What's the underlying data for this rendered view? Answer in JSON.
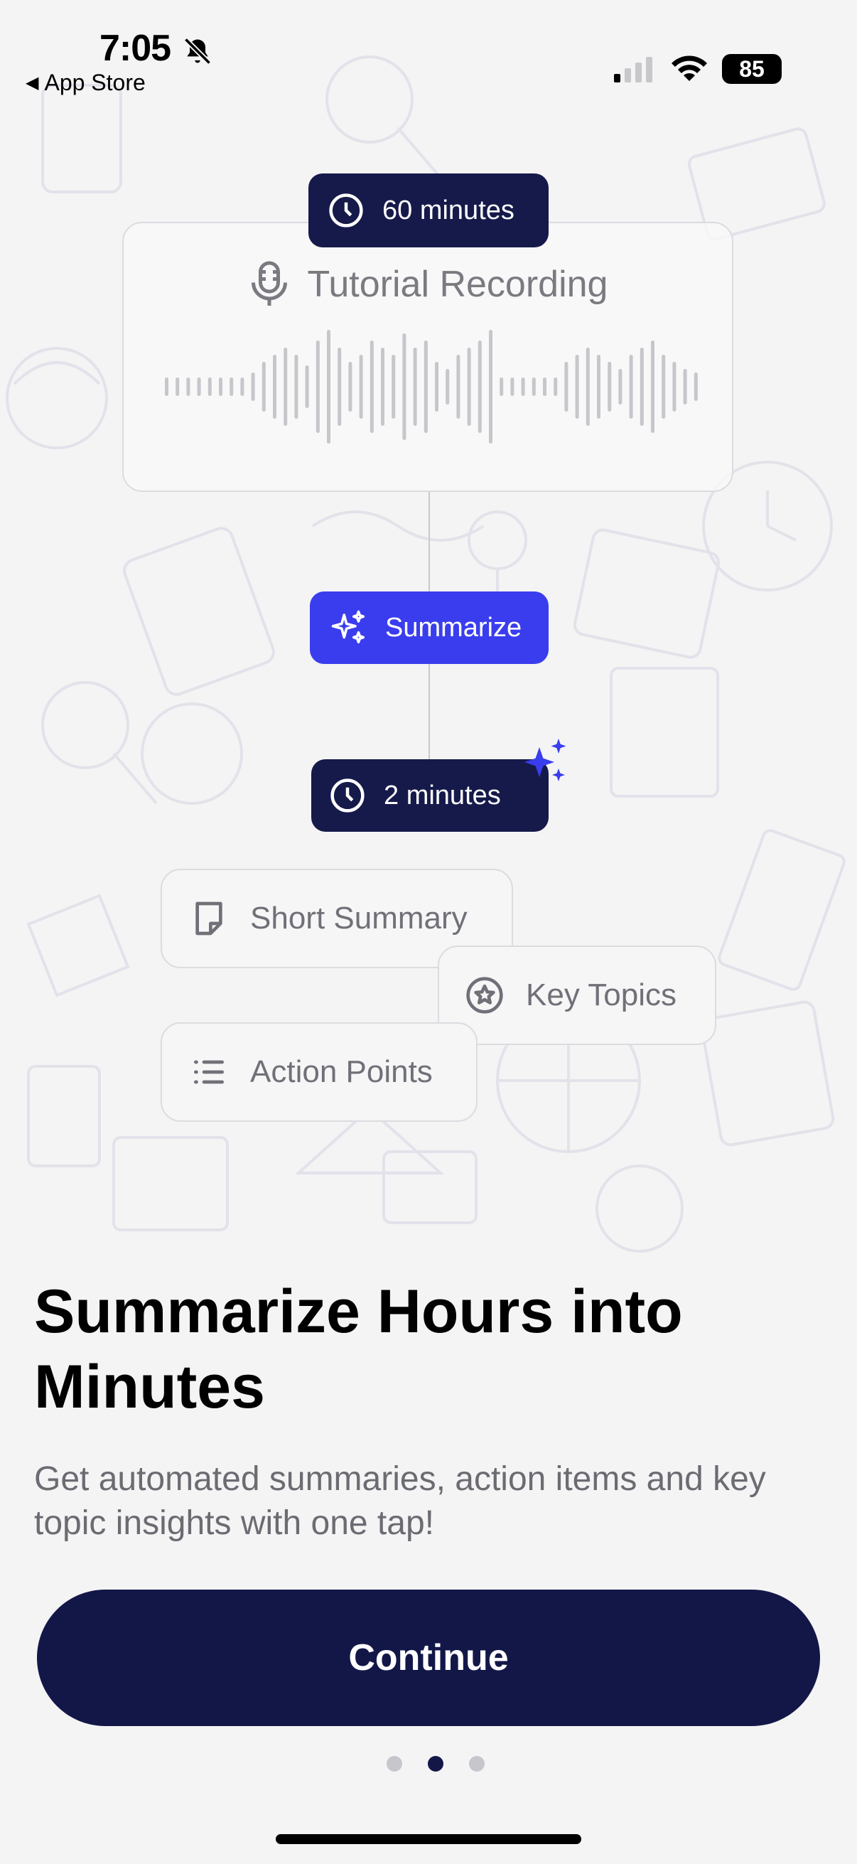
{
  "status_bar": {
    "time": "7:05",
    "back_label": "App Store",
    "battery": "85"
  },
  "recording_card": {
    "duration": "60 minutes",
    "title": "Tutorial Recording"
  },
  "summarize_button": {
    "label": "Summarize"
  },
  "result_duration": {
    "label": "2 minutes"
  },
  "features": {
    "short_summary": "Short Summary",
    "key_topics": "Key Topics",
    "action_points": "Action Points"
  },
  "headline": "Summarize Hours into Minutes",
  "subtext": "Get automated summaries, action items and key topic insights with one tap!",
  "continue_label": "Continue",
  "pagination": {
    "total": 3,
    "active_index": 1
  },
  "colors": {
    "primary_navy": "#131748",
    "accent_blue": "#3a3ded",
    "background": "#f4f4f5"
  },
  "icons": [
    "bell-off-icon",
    "back-arrow-icon",
    "cellular-signal-icon",
    "wifi-icon",
    "battery-icon",
    "clock-icon",
    "microphone-icon",
    "sparkles-icon",
    "document-icon",
    "star-badge-icon",
    "list-icon"
  ]
}
